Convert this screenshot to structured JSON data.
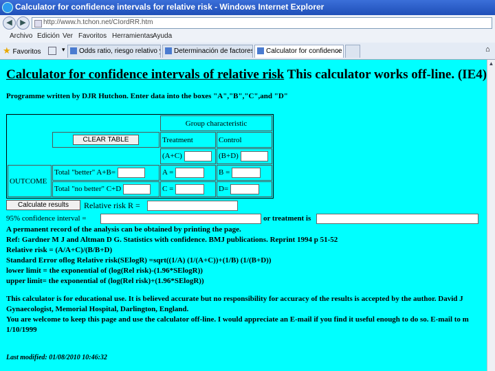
{
  "window": {
    "title": "Calculator for confidence intervals for relative risk - Windows Internet Explorer",
    "address": "http://www.h.tchon.net/CIordRR.htm"
  },
  "menu": [
    "Archivo",
    "Edición",
    "Ver",
    "Favoritos",
    "Herramientas",
    "Ayuda"
  ],
  "favorites_label": "Favoritos",
  "tabs": [
    {
      "label": "Odds ratio, riesgo relativo y p..."
    },
    {
      "label": "Determinación de factores de ..."
    },
    {
      "label": "Calculator for confidence ..."
    }
  ],
  "page": {
    "title_link": "Calculator for confidence intervals of relative risk",
    "title_rest": " This calculator works off-line. (IE4)",
    "programme": "Programme written by DJR Hutchon. Enter data into the boxes \"A\",\"B\",\"C\",and \"D\"",
    "table": {
      "group_header": "Group characteristic",
      "clear_button": "CLEAR TABLE",
      "treatment": "Treatment",
      "control": "Control",
      "a_plus_c": "(A+C)",
      "b_plus_d": "(B+D)",
      "outcome": "OUTCOME",
      "better": "Total \"better\" A+B=",
      "no_better": "Total \"no better\" C+D",
      "a_label": "A =",
      "b_label": "B =",
      "c_label": "C =",
      "d_label": "D="
    },
    "calculate_button": "Calculate results",
    "relative_risk_label": "Relative risk R =",
    "ci_label": "95% confidence interval =",
    "or_treatment_label": "or treatment is",
    "lines": [
      "A permanent record of the analysis can be obtained by printing the page.",
      "Ref: Gardner M J and Altman D G. Statistics with confidence. BMJ publications. Reprint 1994 p 51-52",
      "Relative risk = (A/A+C)/(B/B+D)",
      "Standard Error oflog Relative risk(SElogR) =sqrt((1/A) (1/(A+C))+(1/B) (1/(B+D))",
      "lower limit = the exponential of (log(Rel risk)-(1.96*SElogR))",
      "upper limit= the exponential of (log(Rel risk)+(1.96*SElogR))"
    ],
    "disclaimer": [
      "This calculator is for educational use. It is believed accurate but no responsibility for accuracy of the results is accepted by the author. David J",
      "Gynaecologist, Memorial Hospital, Darlington, England.",
      "You are welcome to keep this page and use the calculator off-line. I would appreciate an E-mail if you find it useful enough to do so. E-mail to m",
      "1/10/1999"
    ],
    "last_modified": "Last modified: 01/08/2010 10:46:32"
  },
  "colors": {
    "page_bg": "#00ffff",
    "titlebar": "#1f4fb8"
  }
}
